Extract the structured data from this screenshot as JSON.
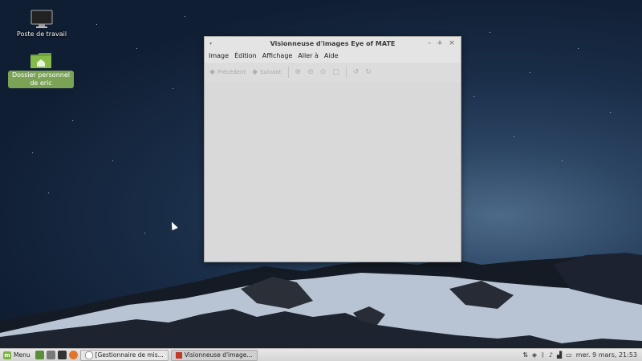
{
  "desktop": {
    "icons": [
      {
        "label": "Poste de travail",
        "icon": "monitor-icon"
      },
      {
        "label": "Dossier personnel de eric",
        "icon": "home-folder-icon"
      }
    ]
  },
  "window": {
    "title": "Visionneuse d'images Eye of MATE",
    "controls": {
      "menu": "▾",
      "minimize": "–",
      "maximize": "+",
      "close": "×"
    },
    "menus": [
      "Image",
      "Édition",
      "Affichage",
      "Aller à",
      "Aide"
    ],
    "toolbar": {
      "previous_label": "Précédent",
      "next_label": "Suivant",
      "icons": [
        "zoom-in-icon",
        "zoom-out-icon",
        "zoom-fit-icon",
        "fullscreen-icon",
        "rotate-left-icon",
        "rotate-right-icon"
      ]
    }
  },
  "panel": {
    "menu_label": "Menu",
    "tasks": [
      {
        "label": "[Gestionnaire de mis..."
      },
      {
        "label": "Visionneuse d'image..."
      }
    ],
    "clock": "mer.  9 mars, 21:53"
  },
  "colors": {
    "mint_green": "#7cb342",
    "desktop_sky": "#1a2e49"
  }
}
